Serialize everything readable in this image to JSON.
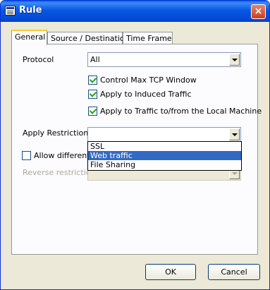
{
  "window": {
    "title": "Rule",
    "close_glyph": "×"
  },
  "tabs": [
    {
      "label": "General",
      "active": true
    },
    {
      "label": "Source / Destination",
      "active": false
    },
    {
      "label": "Time Frame",
      "active": false
    }
  ],
  "protocol": {
    "label": "Protocol",
    "value": "All"
  },
  "checkboxes": [
    {
      "label": "Control Max TCP Window",
      "checked": true
    },
    {
      "label": "Apply to Induced Traffic",
      "checked": true
    },
    {
      "label": "Apply to Traffic to/from the Local Machine",
      "checked": true
    }
  ],
  "apply_restriction": {
    "label": "Apply Restriction:",
    "value": "",
    "options": [
      "SSL",
      "Web traffic",
      "File Sharing"
    ],
    "highlighted": "Web traffic"
  },
  "allow_different": {
    "label": "Allow different re",
    "checked": false
  },
  "reverse_restriction": {
    "label": "Reverse restriction:",
    "value": ""
  },
  "buttons": {
    "ok": "OK",
    "cancel": "Cancel"
  },
  "colors": {
    "titlebar": "#0758e3",
    "selection": "#316ac5",
    "dialog_bg": "#ece9d8"
  }
}
